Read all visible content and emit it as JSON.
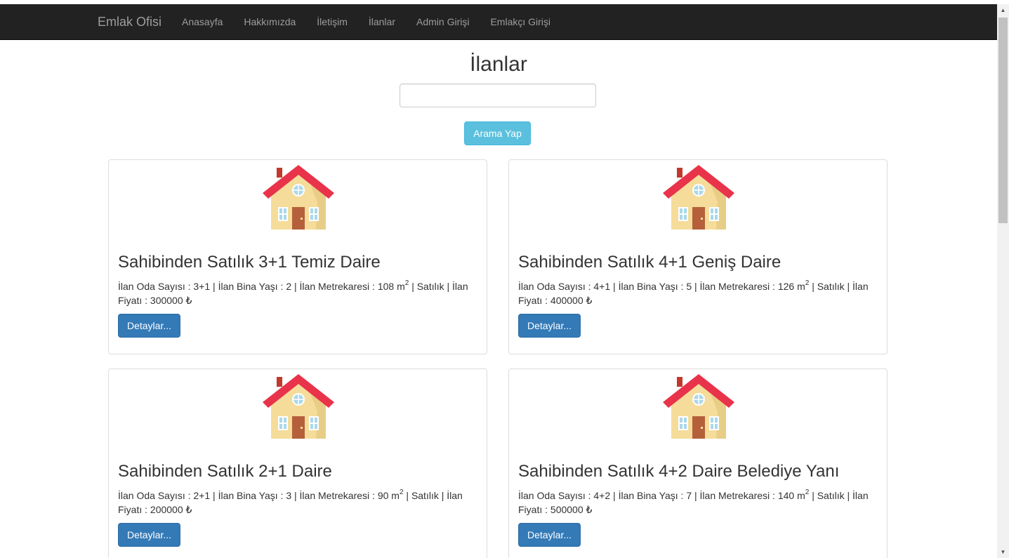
{
  "navbar": {
    "brand": "Emlak Ofisi",
    "items": [
      "Anasayfa",
      "Hakkımızda",
      "İletişim",
      "İlanlar",
      "Admin Girişi",
      "Emlakçı Girişi"
    ]
  },
  "page": {
    "title": "İlanlar",
    "search_value": "",
    "search_button": "Arama Yap"
  },
  "labels": {
    "rooms": "İlan Oda Sayısı :",
    "age": "İlan Bina Yaşı :",
    "area": "İlan Metrekaresi :",
    "area_unit": "m",
    "area_unit_sup": "2",
    "price_prefix": "İlan",
    "price": "Fiyatı :",
    "currency": "₺",
    "separator": "|"
  },
  "listings": [
    {
      "title": "Sahibinden Satılık 3+1 Temiz Daire",
      "rooms": "3+1",
      "age": "2",
      "area": "108",
      "type": "Satılık",
      "price": "300000",
      "button": "Detaylar..."
    },
    {
      "title": "Sahibinden Satılık 4+1 Geniş Daire",
      "rooms": "4+1",
      "age": "5",
      "area": "126",
      "type": "Satılık",
      "price": "400000",
      "button": "Detaylar..."
    },
    {
      "title": "Sahibinden Satılık 2+1 Daire",
      "rooms": "2+1",
      "age": "3",
      "area": "90",
      "type": "Satılık",
      "price": "200000",
      "button": "Detaylar..."
    },
    {
      "title": "Sahibinden Satılık 4+2 Daire Belediye Yanı",
      "rooms": "4+2",
      "age": "7",
      "area": "140",
      "type": "Satılık",
      "price": "500000",
      "button": "Detaylar..."
    }
  ],
  "icons": {
    "house": "house-icon",
    "scroll_up": "scroll-up-arrow-icon",
    "scroll_down": "scroll-down-arrow-icon"
  },
  "colors": {
    "navbar_bg": "#222222",
    "nav_text": "#9d9d9d",
    "search_button": "#5bc0de",
    "detail_button": "#337ab7",
    "roof": "#e8334a",
    "wall": "#f5dc9a",
    "door": "#b5603a"
  }
}
